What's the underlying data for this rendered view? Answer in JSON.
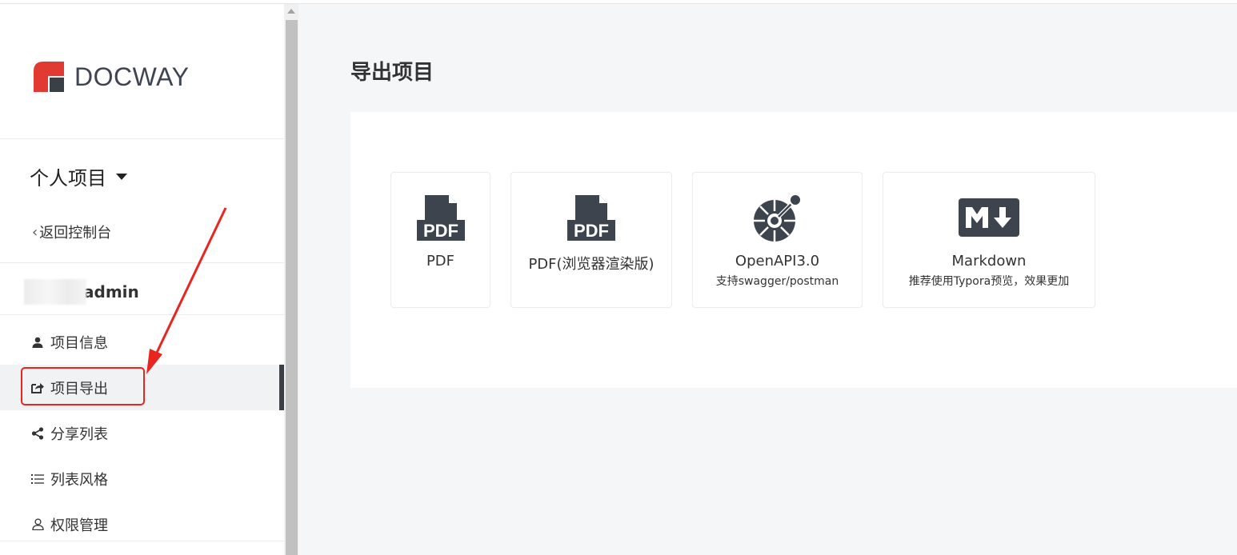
{
  "brand": {
    "name": "DOCWAY"
  },
  "sidebar": {
    "project_selector": "个人项目",
    "back_label": "返回控制台",
    "user_name": "admin",
    "items": [
      {
        "label": "项目信息",
        "icon": "user-icon",
        "active": false
      },
      {
        "label": "项目导出",
        "icon": "share-square-icon",
        "active": true
      },
      {
        "label": "分享列表",
        "icon": "share-nodes-icon",
        "active": false
      },
      {
        "label": "列表风格",
        "icon": "list-icon",
        "active": false
      },
      {
        "label": "权限管理",
        "icon": "user-outline-icon",
        "active": false
      }
    ]
  },
  "main": {
    "title": "导出项目",
    "export_options": [
      {
        "label": "PDF",
        "sublabel": "",
        "icon": "pdf-icon"
      },
      {
        "label": "PDF(浏览器渲染版)",
        "sublabel": "",
        "icon": "pdf-icon"
      },
      {
        "label": "OpenAPI3.0",
        "sublabel": "支持swagger/postman",
        "icon": "openapi-icon"
      },
      {
        "label": "Markdown",
        "sublabel": "推荐使用Typora预览，效果更加",
        "icon": "markdown-icon"
      }
    ]
  },
  "colors": {
    "accent_dark": "#3b3f46",
    "brand_red": "#e03a33",
    "annotation_red": "#e8261f"
  }
}
